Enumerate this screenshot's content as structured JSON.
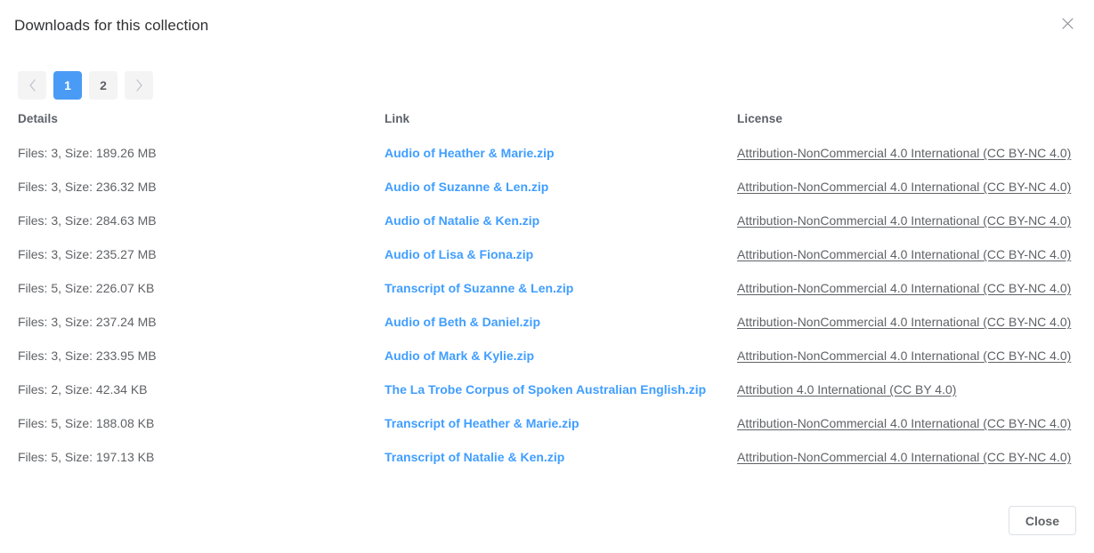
{
  "dialog": {
    "title": "Downloads for this collection",
    "close_icon": "close-icon",
    "footer": {
      "close_label": "Close"
    }
  },
  "pagination": {
    "prev_icon": "chevron-left-icon",
    "next_icon": "chevron-right-icon",
    "pages": [
      "1",
      "2"
    ],
    "current_page": "1",
    "active_color": "#4a9bf5",
    "inactive_bg": "#f4f4f5"
  },
  "table": {
    "columns": [
      "Details",
      "Link",
      "License"
    ],
    "rows": [
      {
        "details": "Files: 3, Size: 189.26 MB",
        "link": "Audio of Heather & Marie.zip",
        "license": "Attribution-NonCommercial 4.0 International (CC BY-NC 4.0)"
      },
      {
        "details": "Files: 3, Size: 236.32 MB",
        "link": "Audio of Suzanne & Len.zip",
        "license": "Attribution-NonCommercial 4.0 International (CC BY-NC 4.0)"
      },
      {
        "details": "Files: 3, Size: 284.63 MB",
        "link": "Audio of Natalie & Ken.zip",
        "license": "Attribution-NonCommercial 4.0 International (CC BY-NC 4.0)"
      },
      {
        "details": "Files: 3, Size: 235.27 MB",
        "link": "Audio of Lisa & Fiona.zip",
        "license": "Attribution-NonCommercial 4.0 International (CC BY-NC 4.0)"
      },
      {
        "details": "Files: 5, Size: 226.07 KB",
        "link": "Transcript of Suzanne & Len.zip",
        "license": "Attribution-NonCommercial 4.0 International (CC BY-NC 4.0)"
      },
      {
        "details": "Files: 3, Size: 237.24 MB",
        "link": "Audio of Beth & Daniel.zip",
        "license": "Attribution-NonCommercial 4.0 International (CC BY-NC 4.0)"
      },
      {
        "details": "Files: 3, Size: 233.95 MB",
        "link": "Audio of Mark & Kylie.zip",
        "license": "Attribution-NonCommercial 4.0 International (CC BY-NC 4.0)"
      },
      {
        "details": "Files: 2, Size: 42.34 KB",
        "link": "The La Trobe Corpus of Spoken Australian English.zip",
        "license": "Attribution 4.0 International (CC BY 4.0)"
      },
      {
        "details": "Files: 5, Size: 188.08 KB",
        "link": "Transcript of Heather & Marie.zip",
        "license": "Attribution-NonCommercial 4.0 International (CC BY-NC 4.0)"
      },
      {
        "details": "Files: 5, Size: 197.13 KB",
        "link": "Transcript of Natalie & Ken.zip",
        "license": "Attribution-NonCommercial 4.0 International (CC BY-NC 4.0)"
      }
    ]
  },
  "colors": {
    "link_blue": "#409eff",
    "text_gray": "#606266",
    "header_gray": "#5c6169",
    "border_gray": "#dcdfe6"
  }
}
